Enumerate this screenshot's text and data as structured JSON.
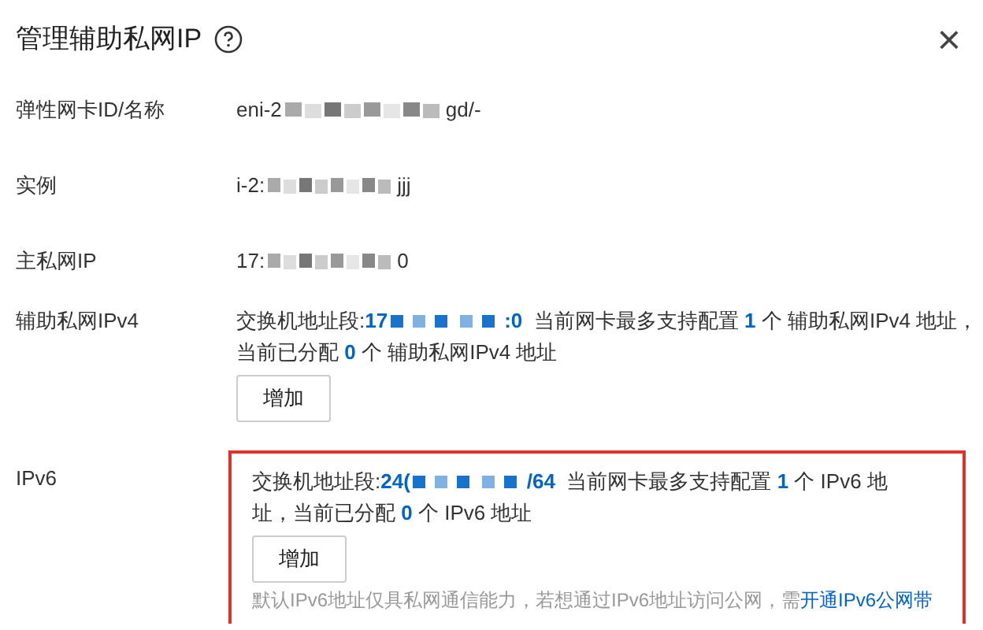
{
  "dialog": {
    "title": "管理辅助私网IP",
    "close": "×"
  },
  "fields": [
    {
      "kind": "masked",
      "label": "弹性网卡ID/名称",
      "prefix": "eni-2",
      "suffix": "gd/-"
    },
    {
      "kind": "masked",
      "label": "实例",
      "prefix": "i-2:",
      "suffix": "jjj"
    },
    {
      "kind": "masked",
      "label": "主私网IP",
      "prefix": "17:",
      "suffix": "0"
    },
    {
      "kind": "quota",
      "label": "辅助私网IPv4",
      "highlighted": false,
      "before": "交换机地址段:**17**",
      "after": "**:0**  当前网卡最多支持配置 **1** 个 辅助私网IPv4 地址，",
      "line2": "当前已分配 **0** 个 辅助私网IPv4 地址",
      "button": "增加"
    },
    {
      "kind": "quota",
      "label": "IPv6",
      "highlighted": true,
      "before": "交换机地址段:**24(**",
      "after": "**/64**  当前网卡最多支持配置 **1** 个 IPv6 地",
      "line2": "址，当前已分配 **0** 个 IPv6 地址",
      "button": "增加",
      "note": "默认IPv6地址仅具私网通信能力，若想通过IPv6地址访问公网，需",
      "note_link": "开通IPv6公网带"
    }
  ]
}
